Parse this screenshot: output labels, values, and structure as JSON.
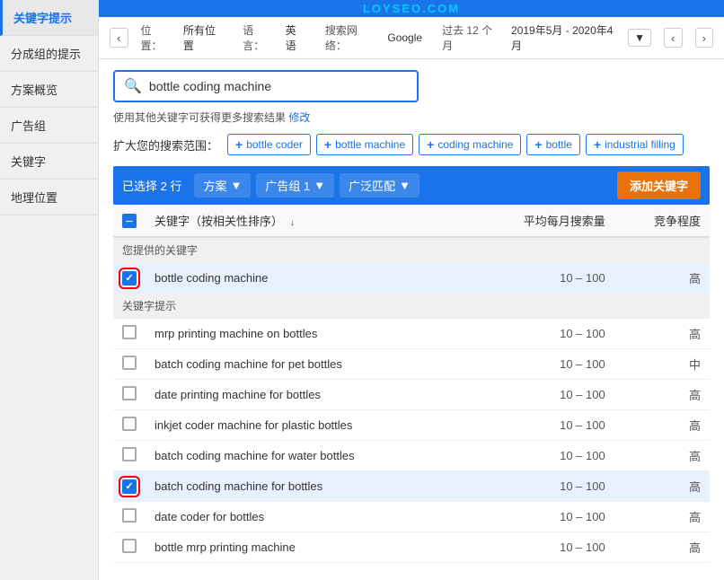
{
  "sidebar": {
    "items": [
      {
        "label": "关键字提示"
      },
      {
        "label": "分成组的提示"
      },
      {
        "label": "方案概览"
      },
      {
        "label": "广告组"
      },
      {
        "label": "关键字"
      },
      {
        "label": "地理位置"
      }
    ]
  },
  "topbar": {
    "back_label": "‹",
    "forward_label": "›",
    "location_label": "位置：",
    "location_value": "所有位置",
    "language_label": "语言：",
    "language_value": "英语",
    "network_label": "搜索网络：",
    "network_value": "Google",
    "date_label": "过去 12 个月",
    "date_value": "2019年5月 - 2020年4月",
    "brand": "LOYSEO.COM",
    "dropdown_arrow": "▼",
    "nav_prev": "‹",
    "nav_next": "›"
  },
  "search": {
    "placeholder": "bottle coding machine",
    "value": "bottle coding machine",
    "icon": "🔍"
  },
  "hint": {
    "text": "使用其他关键字可获得更多搜索结果",
    "link_text": "修改"
  },
  "expand": {
    "label": "扩大您的搜索范围：",
    "tags": [
      {
        "label": "bottle coder"
      },
      {
        "label": "bottle machine"
      },
      {
        "label": "coding machine"
      },
      {
        "label": "bottle"
      },
      {
        "label": "industrial filling"
      }
    ]
  },
  "toolbar": {
    "selected_info": "已选择 2 行",
    "plan_label": "方案",
    "adgroup_label": "广告组 1",
    "match_label": "广泛匹配",
    "add_label": "添加关键字",
    "dropdown_arrow": "▼"
  },
  "table": {
    "headers": [
      {
        "label": "关键字（按相关性排序）",
        "sortable": true
      },
      {
        "label": "平均每月搜索量",
        "align": "right"
      },
      {
        "label": "竞争程度",
        "align": "right"
      }
    ],
    "section_provided": "您提供的关键字",
    "section_suggestions": "关键字提示",
    "provided_rows": [
      {
        "keyword": "bottle coding machine",
        "monthly": "10 – 100",
        "competition": "高",
        "checked": true,
        "red_outline": true
      }
    ],
    "suggestion_rows": [
      {
        "keyword": "mrp printing machine on bottles",
        "monthly": "10 – 100",
        "competition": "高",
        "checked": false,
        "red_outline": false
      },
      {
        "keyword": "batch coding machine for pet bottles",
        "monthly": "10 – 100",
        "competition": "中",
        "checked": false,
        "red_outline": false
      },
      {
        "keyword": "date printing machine for bottles",
        "monthly": "10 – 100",
        "competition": "高",
        "checked": false,
        "red_outline": false
      },
      {
        "keyword": "inkjet coder machine for plastic bottles",
        "monthly": "10 – 100",
        "competition": "高",
        "checked": false,
        "red_outline": false
      },
      {
        "keyword": "batch coding machine for water bottles",
        "monthly": "10 – 100",
        "competition": "高",
        "checked": false,
        "red_outline": false
      },
      {
        "keyword": "batch coding machine for bottles",
        "monthly": "10 – 100",
        "competition": "高",
        "checked": true,
        "red_outline": true
      },
      {
        "keyword": "date coder for bottles",
        "monthly": "10 – 100",
        "competition": "高",
        "checked": false,
        "red_outline": false
      },
      {
        "keyword": "bottle mrp printing machine",
        "monthly": "10 – 100",
        "competition": "高",
        "checked": false,
        "red_outline": false
      }
    ]
  }
}
